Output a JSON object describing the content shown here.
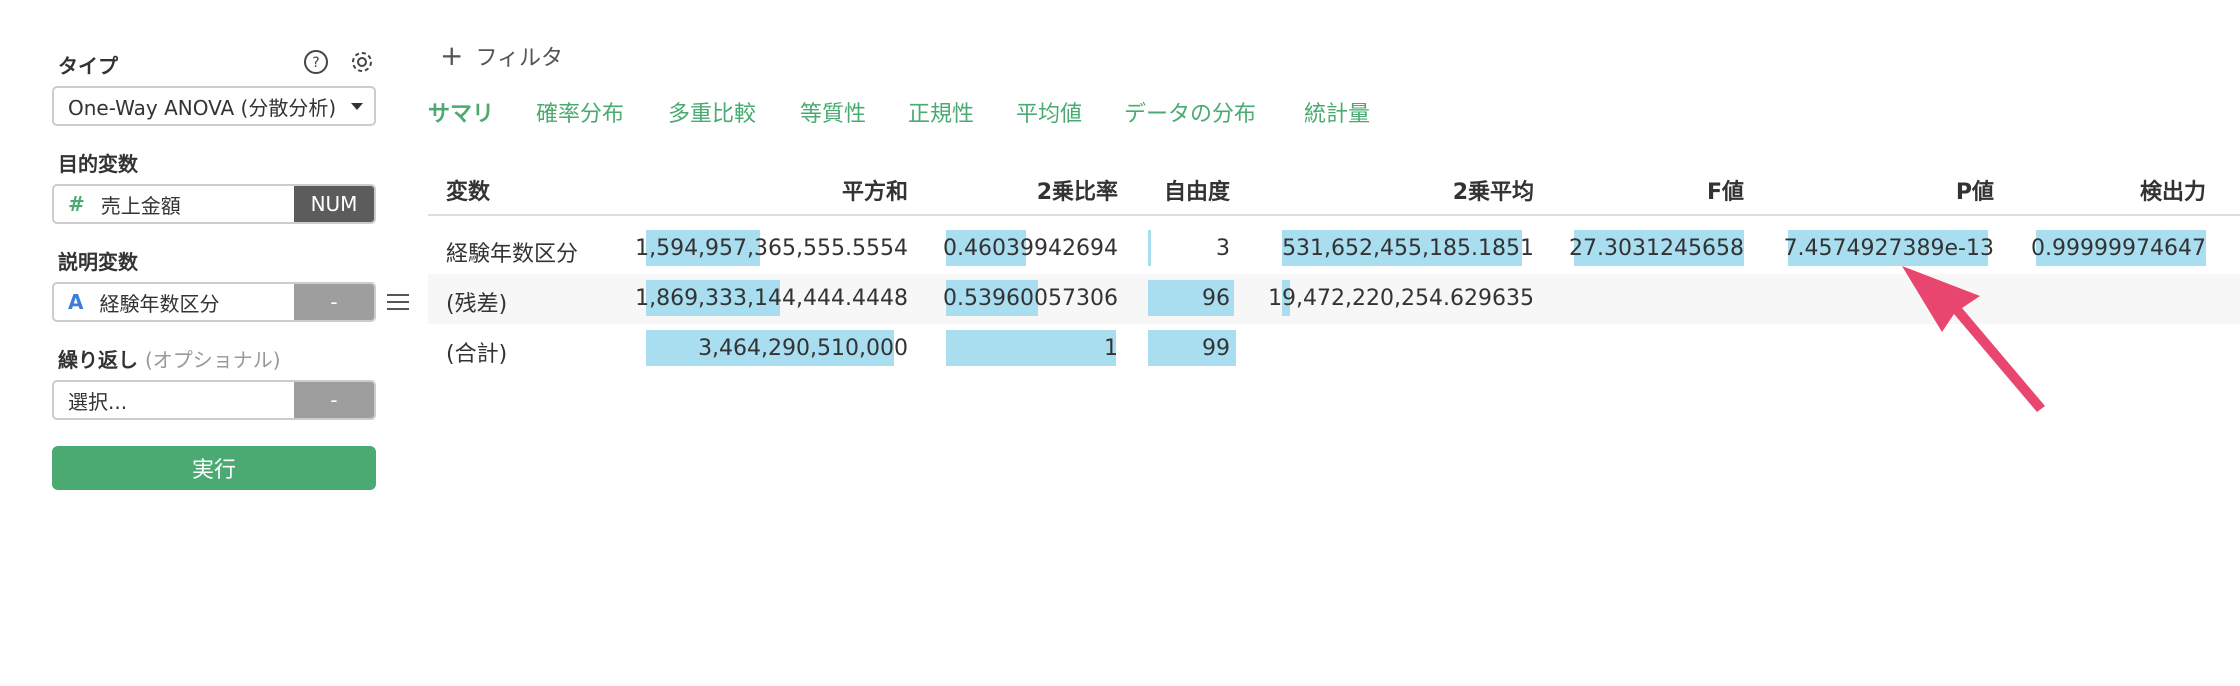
{
  "sidebar": {
    "type_label": "タイプ",
    "type_value": "One-Way ANOVA (分散分析)",
    "target_label": "目的変数",
    "target_field": {
      "icon": "#",
      "value": "売上金額",
      "tag": "NUM"
    },
    "explanatory_label": "説明変数",
    "explanatory_field": {
      "icon": "A",
      "value": "経験年数区分",
      "tag": "-"
    },
    "repeat_label": "繰り返し",
    "repeat_optional": "(オプショナル)",
    "repeat_field": {
      "placeholder": "選択...",
      "tag": "-"
    },
    "run_label": "実行"
  },
  "toolbar": {
    "filter_icon": "+",
    "filter_label": "フィルタ"
  },
  "tabs": [
    {
      "label": "サマリ",
      "active": true
    },
    {
      "label": "確率分布"
    },
    {
      "label": "多重比較"
    },
    {
      "label": "等質性"
    },
    {
      "label": "正規性"
    },
    {
      "label": "平均値"
    },
    {
      "label": "データの分布"
    },
    {
      "label": "統計量"
    }
  ],
  "table": {
    "headers": [
      "変数",
      "平方和",
      "2乗比率",
      "自由度",
      "2乗平均",
      "F値",
      "P値",
      "検出力"
    ],
    "rows": [
      [
        "経験年数区分",
        "1,594,957,365,555.5554",
        "0.46039942694",
        "3",
        "531,652,455,185.1851",
        "27.3031245658",
        "7.4574927389e-13",
        "0.99999974647"
      ],
      [
        "(残差)",
        "1,869,333,144,444.4448",
        "0.53960057306",
        "96",
        "19,472,220,254.629635",
        "",
        "",
        ""
      ],
      [
        "(合計)",
        "3,464,290,510,000",
        "1",
        "99",
        "",
        "",
        "",
        ""
      ]
    ]
  },
  "colors": {
    "accent": "#4aaa72",
    "bar": "#a8def0",
    "arrow": "#e8466f",
    "tag_dark": "#5c5c5c",
    "tag_gray": "#9e9e9e"
  }
}
